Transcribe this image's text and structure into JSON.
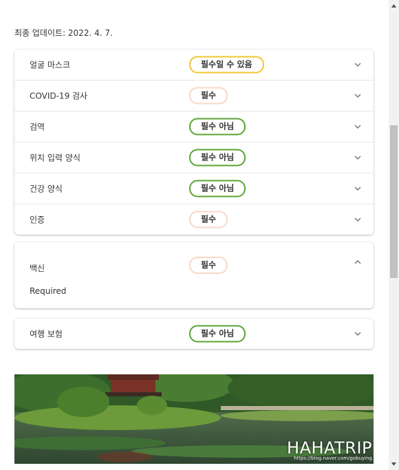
{
  "updated": "최종 업데이트: 2022. 4. 7.",
  "items": [
    {
      "label": "얼굴 마스크",
      "status": "필수일 수 있음"
    },
    {
      "label": "COVID-19 검사",
      "status": "필수"
    },
    {
      "label": "검역",
      "status": "필수 아님"
    },
    {
      "label": "위치 입력 양식",
      "status": "필수 아님"
    },
    {
      "label": "건강 양식",
      "status": "필수 아님"
    },
    {
      "label": "인증",
      "status": "필수"
    }
  ],
  "vaccine": {
    "label": "백신",
    "status": "필수",
    "detail": "Required"
  },
  "insurance": {
    "label": "여행 보험",
    "status": "필수 아님"
  },
  "photo": {
    "watermark_big": "HAHATRIP",
    "watermark_small": "https://blog.naver.com/gobuying"
  },
  "colors": {
    "maybe_required": "#f2c530",
    "required": "#f8d7c6",
    "not_required": "#5aa332"
  },
  "icons": {
    "collapsed": "chevron-down-icon",
    "expanded": "chevron-up-icon"
  }
}
